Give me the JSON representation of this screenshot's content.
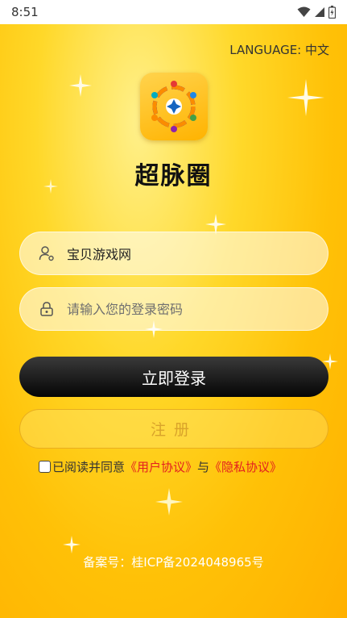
{
  "status_bar": {
    "time": "8:51",
    "icons": [
      "wifi-icon",
      "signal-icon",
      "battery-icon"
    ]
  },
  "language": {
    "label": "LANGUAGE: 中文"
  },
  "app": {
    "logo": "app-logo-icon",
    "name": "超脉圈"
  },
  "login_form": {
    "username": {
      "value": "宝贝游戏网",
      "icon": "user-icon"
    },
    "password": {
      "placeholder": "请输入您的登录密码",
      "icon": "lock-icon"
    },
    "login_label": "立即登录",
    "register_label": "注册"
  },
  "agreement": {
    "prefix": "已阅读并同意",
    "user_agreement": "《用户协议》",
    "conjunction": "与",
    "privacy_agreement": "《隐私协议》",
    "checked": false
  },
  "footer": {
    "icp": "备案号：桂ICP备2024048965号"
  },
  "colors": {
    "background": "#ffc107",
    "link_red": "#e32020",
    "login_button": "#111111",
    "register_text": "#d9a32a"
  }
}
